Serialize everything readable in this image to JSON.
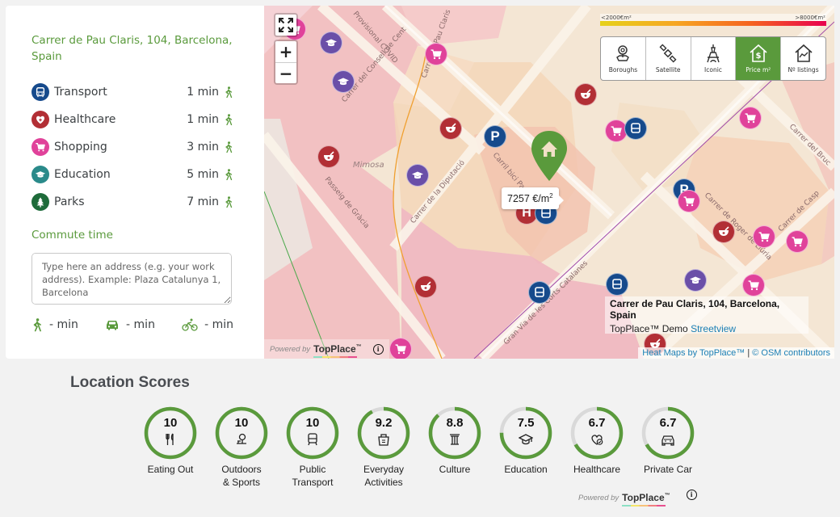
{
  "sidebar": {
    "address": "Carrer de Pau Claris, 104, Barcelona, Spain",
    "poi": [
      {
        "label": "Transport",
        "time": "1 min",
        "icon": "bus-icon",
        "color": "#164a8c"
      },
      {
        "label": "Healthcare",
        "time": "1 min",
        "icon": "heart-plus-icon",
        "color": "#b22f35"
      },
      {
        "label": "Shopping",
        "time": "3 min",
        "icon": "cart-icon",
        "color": "#e0429a"
      },
      {
        "label": "Education",
        "time": "5 min",
        "icon": "graduation-cap-icon",
        "color": "#2a8a8a"
      },
      {
        "label": "Parks",
        "time": "7 min",
        "icon": "tree-icon",
        "color": "#1e6b3a"
      }
    ],
    "commute_title": "Commute time",
    "commute_placeholder": "Type here an address (e.g. your work address). Example: Plaza Catalunya 1, Barcelona",
    "modes": [
      {
        "mode": "walk",
        "value": "- min"
      },
      {
        "mode": "car",
        "value": "- min"
      },
      {
        "mode": "bike",
        "value": "- min"
      }
    ]
  },
  "map": {
    "legend_min": "<2000€m²",
    "legend_max": ">8000€m²",
    "layers": [
      {
        "label": "Boroughs",
        "active": false
      },
      {
        "label": "Satellite",
        "active": false
      },
      {
        "label": "Iconic",
        "active": false
      },
      {
        "label": "Price m²",
        "active": true
      },
      {
        "label": "Nº listings",
        "active": false
      }
    ],
    "zoom_in": "+",
    "zoom_out": "−",
    "price_value": "7257 €/m",
    "price_sup": "2",
    "info_title": "Carrer de Pau Claris, 104, Barcelona, Spain",
    "info_demo": "TopPlace™ Demo",
    "info_link": "Streetview",
    "attribution_heat": "Heat Maps by TopPlace™",
    "attribution_sep": " | ",
    "attribution_osm": "© OSM contributors",
    "powered_by": "Powered by",
    "brand": "TopPlace",
    "brand_tm": "™",
    "street_labels": [
      "Carrer del Consell de Cent",
      "Carrer de la Diputació",
      "Passeig de Gràcia",
      "Gran Via de les Corts Catalanes",
      "Carrer de Pau Claris",
      "Carrer del Bruc",
      "Carrer de Casp",
      "Carrer de Roger de Llúria",
      "Carril bici Pau Claris",
      "Mimosa",
      "Provisional COVID"
    ],
    "accent": "#5a9a3c"
  },
  "scores": {
    "title": "Location Scores",
    "items": [
      {
        "value": "10",
        "score": 10,
        "label": "Eating Out",
        "icon": "cutlery-icon"
      },
      {
        "value": "10",
        "score": 10,
        "label": "Outdoors\n& Sports",
        "icon": "tree-bench-icon"
      },
      {
        "value": "10",
        "score": 10,
        "label": "Public\nTransport",
        "icon": "train-icon"
      },
      {
        "value": "9.2",
        "score": 9.2,
        "label": "Everyday\nActivities",
        "icon": "shopping-bag-icon"
      },
      {
        "value": "8.8",
        "score": 8.8,
        "label": "Culture",
        "icon": "column-icon"
      },
      {
        "value": "7.5",
        "score": 7.5,
        "label": "Education",
        "icon": "graduation-cap-icon"
      },
      {
        "value": "6.7",
        "score": 6.7,
        "label": "Healthcare",
        "icon": "heart-check-icon"
      },
      {
        "value": "6.7",
        "score": 6.7,
        "label": "Private Car",
        "icon": "car-icon"
      }
    ],
    "ring_color": "#5a9a3c",
    "track_color": "#d9d9d9",
    "powered_by": "Powered by",
    "brand": "TopPlace",
    "brand_tm": "™"
  }
}
